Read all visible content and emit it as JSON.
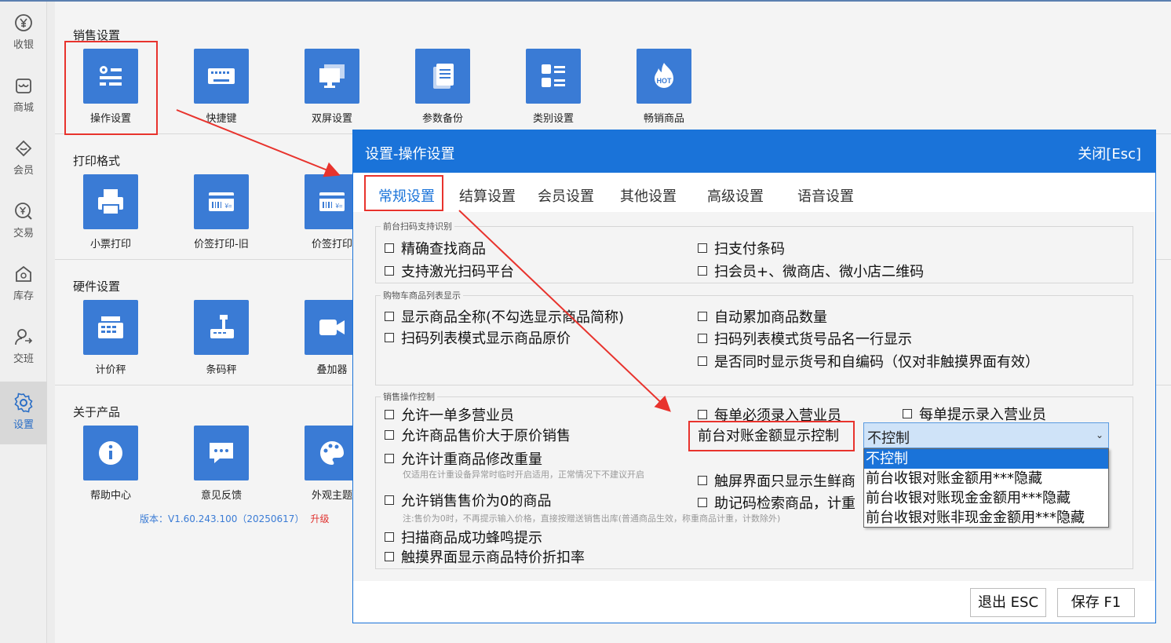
{
  "nav": {
    "items": [
      {
        "label": "收银",
        "icon": "yen-coin-icon"
      },
      {
        "label": "商城",
        "icon": "shop-icon"
      },
      {
        "label": "会员",
        "icon": "member-heart-icon"
      },
      {
        "label": "交易",
        "icon": "yen-search-icon"
      },
      {
        "label": "库存",
        "icon": "warehouse-icon"
      },
      {
        "label": "交班",
        "icon": "user-handover-icon"
      },
      {
        "label": "设置",
        "icon": "gear-icon"
      }
    ],
    "active": "设置"
  },
  "sections": {
    "sales": {
      "title": "销售设置",
      "tiles": [
        "操作设置",
        "快捷键",
        "双屏设置",
        "参数备份",
        "类别设置",
        "畅销商品"
      ]
    },
    "print": {
      "title": "打印格式",
      "tiles": [
        "小票打印",
        "价签打印-旧",
        "价签打印"
      ]
    },
    "hardware": {
      "title": "硬件设置",
      "tiles": [
        "计价秤",
        "条码秤",
        "叠加器"
      ]
    },
    "about": {
      "title": "关于产品",
      "tiles": [
        "帮助中心",
        "意见反馈",
        "外观主题"
      ],
      "version": "版本：V1.60.243.100（20250617）",
      "upgrade": "升级"
    }
  },
  "dialog": {
    "title": "设置-操作设置",
    "close": "关闭[Esc]",
    "tabs": [
      "常规设置",
      "结算设置",
      "会员设置",
      "其他设置",
      "高级设置",
      "语音设置"
    ],
    "active_tab": "常规设置",
    "groups": {
      "scan": {
        "legend": "前台扫码支持识别",
        "items": [
          "精确查找商品",
          "扫支付条码",
          "支持激光扫码平台",
          "扫会员+、微商店、微小店二维码"
        ]
      },
      "cart": {
        "legend": "购物车商品列表显示",
        "items": [
          "显示商品全称(不勾选显示商品简称)",
          "自动累加商品数量",
          "扫码列表模式显示商品原价",
          "扫码列表模式货号品名一行显示",
          "是否同时显示货号和自编码（仅对非触摸界面有效）"
        ]
      },
      "sales_ctrl": {
        "legend": "销售操作控制",
        "items": [
          "允许一单多营业员",
          "每单必须录入营业员",
          "每单提示录入营业员",
          "允许商品售价大于原价销售",
          "允许计重商品修改重量",
          "触屏界面只显示生鲜商",
          "允许销售售价为0的商品",
          "助记码检索商品，计重",
          "扫描商品成功蜂鸣提示",
          "触摸界面显示商品特价折扣率"
        ],
        "notes": [
          "仅适用在计重设备异常时临时开启适用，正常情况下不建议开启",
          "注:售价为0时，不再提示输入价格，直接按赠送销售出库(普通商品生效，称重商品计重，计数除外)"
        ],
        "amount_label": "前台对账金额显示控制",
        "select_value": "不控制",
        "options": [
          "不控制",
          "前台收银对账金额用***隐藏",
          "前台收银对账现金金额用***隐藏",
          "前台收银对账非现金金额用***隐藏"
        ]
      }
    },
    "buttons": {
      "exit": "退出 ESC",
      "save": "保存 F1"
    }
  },
  "colors": {
    "accent": "#1a73d9",
    "tile": "#3a7bd5",
    "highlight": "#e8332d"
  }
}
